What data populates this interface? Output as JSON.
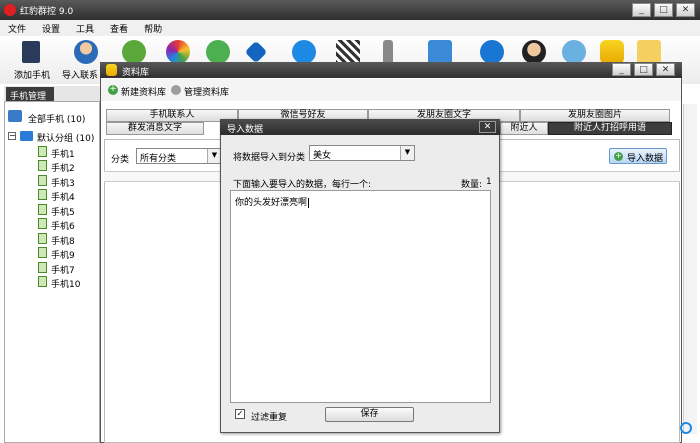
{
  "app": {
    "title": "红豹群控 9.0",
    "window_buttons": [
      "_",
      "□",
      "✕"
    ]
  },
  "menu": [
    "文件",
    "设置",
    "工具",
    "查看",
    "帮助"
  ],
  "toolbar": {
    "add_phone": "添加手机",
    "import_contacts": "导入联系"
  },
  "left_panel": {
    "tab": "手机管理",
    "all_phones": "全部手机 (10)",
    "default_group": "默认分组 (10)",
    "phones": [
      "手机1",
      "手机2",
      "手机3",
      "手机4",
      "手机5",
      "手机6",
      "手机8",
      "手机9",
      "手机7",
      "手机10"
    ]
  },
  "library_window": {
    "title": "资料库",
    "new_library": "新建资料库",
    "manage_library": "管理资料库",
    "tabs_row1": [
      "手机联系人",
      "微信号好友",
      "发朋友圈文字",
      "发朋友圈图片"
    ],
    "tabs_row2": [
      "群发消息文字",
      "附近人",
      "附近人打招呼用语"
    ],
    "category_label": "分类",
    "category_value": "所有分类",
    "import_data_button": "导入数据"
  },
  "dialog": {
    "title": "导入数据",
    "import_to_label": "将数据导入到分类",
    "category_value": "美女",
    "instruction": "下面输入要导入的数据，每行一个:",
    "count_label": "数量:",
    "count_value": "1",
    "textarea_value": "你的头发好漂亮啊",
    "filter_label": "过滤重复",
    "save_button": "保存"
  }
}
